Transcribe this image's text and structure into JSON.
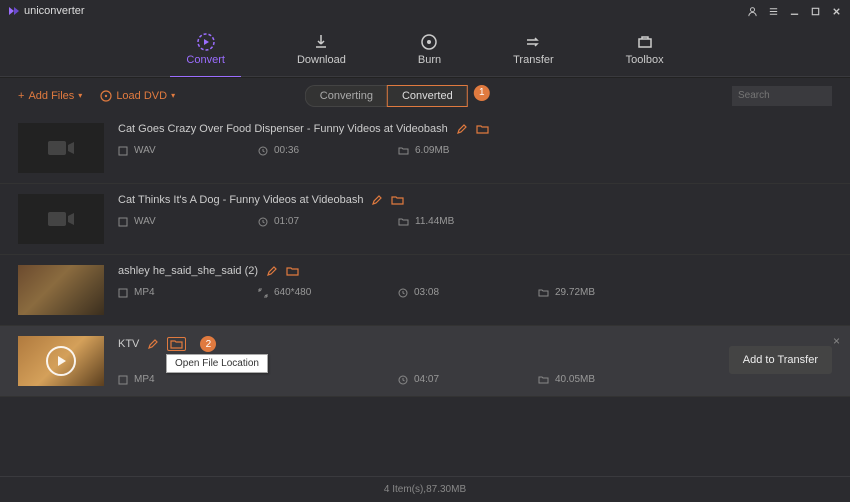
{
  "app_name": "uniconverter",
  "nav": {
    "convert": "Convert",
    "download": "Download",
    "burn": "Burn",
    "transfer": "Transfer",
    "toolbox": "Toolbox"
  },
  "toolbar": {
    "add_files": "Add Files",
    "load_dvd": "Load DVD",
    "tab_converting": "Converting",
    "tab_converted": "Converted",
    "badge1": "1",
    "search_placeholder": "Search"
  },
  "items": [
    {
      "title": "Cat Goes Crazy Over Food Dispenser - Funny Videos at Videobash",
      "format": "WAV",
      "duration": "00:36",
      "size": "6.09MB",
      "dim": ""
    },
    {
      "title": "Cat Thinks It's A Dog - Funny Videos at Videobash",
      "format": "WAV",
      "duration": "01:07",
      "size": "11.44MB",
      "dim": ""
    },
    {
      "title": "ashley he_said_she_said (2)",
      "format": "MP4",
      "duration": "03:08",
      "size": "29.72MB",
      "dim": "640*480"
    },
    {
      "title": "KTV",
      "format": "MP4",
      "duration": "04:07",
      "size": "40.05MB",
      "dim": ""
    }
  ],
  "badge2": "2",
  "tooltip_open_location": "Open File Location",
  "add_to_transfer": "Add to Transfer",
  "footer": "4 Item(s),87.30MB"
}
